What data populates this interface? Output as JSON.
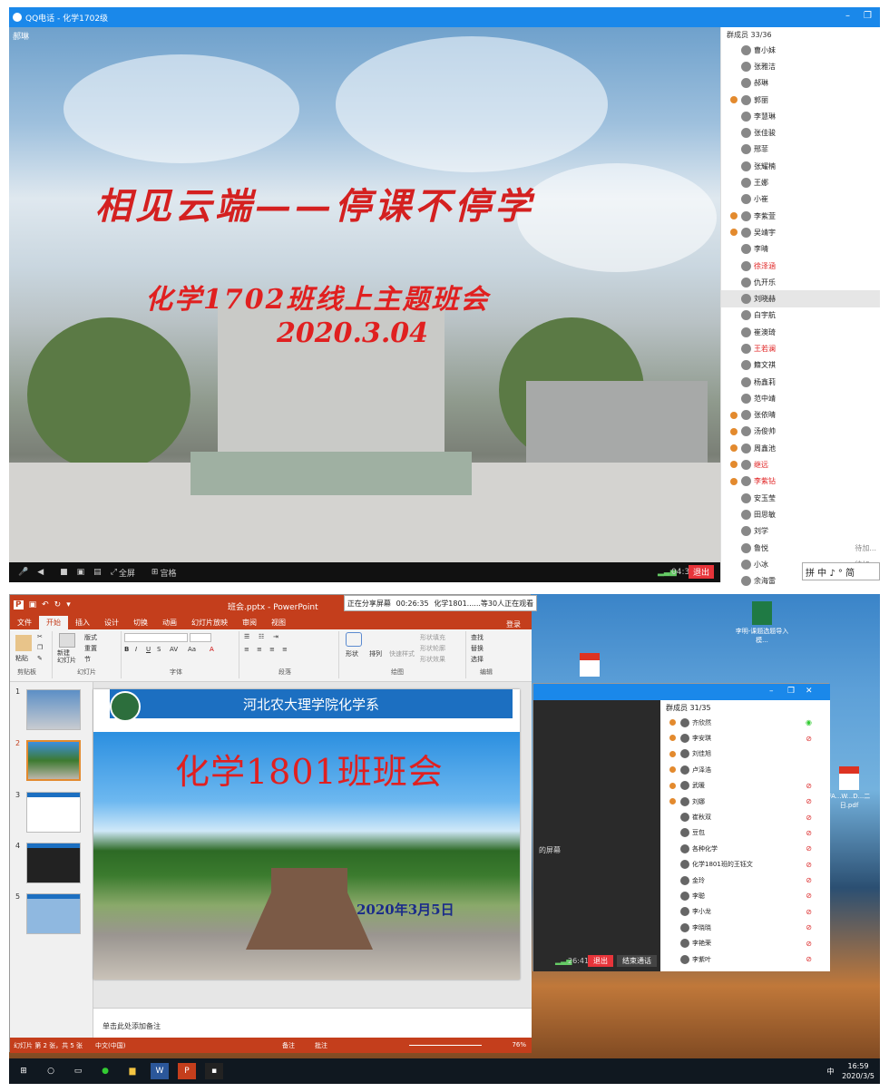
{
  "qq_top": {
    "title": "QQ电话 - 化学1702级",
    "speaker": "郝琳",
    "slide_title": "相见云端——停课不停学",
    "slide_subtitle": "化学1702班线上主题班会",
    "slide_date": "2020.3.04",
    "controls": {
      "fullscreen": "全屏",
      "grid": "宫格",
      "time": "04:34",
      "exit": "退出"
    },
    "member_header": "群成员 33/36",
    "members": [
      {
        "name": "曹小妹",
        "admin": false,
        "red": false
      },
      {
        "name": "张雅洁",
        "admin": false,
        "red": false
      },
      {
        "name": "郝琳",
        "admin": false,
        "red": false
      },
      {
        "name": "郭丽",
        "admin": true,
        "red": false
      },
      {
        "name": "李慧琳",
        "admin": false,
        "red": false
      },
      {
        "name": "张佳骏",
        "admin": false,
        "red": false
      },
      {
        "name": "邢菲",
        "admin": false,
        "red": false
      },
      {
        "name": "张耀楠",
        "admin": false,
        "red": false
      },
      {
        "name": "王娜",
        "admin": false,
        "red": false
      },
      {
        "name": "小崔",
        "admin": false,
        "red": false
      },
      {
        "name": "李紫萱",
        "admin": true,
        "red": false
      },
      {
        "name": "吴靖宇",
        "admin": true,
        "red": false
      },
      {
        "name": "李晴",
        "admin": false,
        "red": false
      },
      {
        "name": "徐泽涵",
        "admin": false,
        "red": true
      },
      {
        "name": "仇开乐",
        "admin": false,
        "red": false
      },
      {
        "name": "刘晓赫",
        "admin": false,
        "red": false,
        "selected": true
      },
      {
        "name": "白宇航",
        "admin": false,
        "red": false
      },
      {
        "name": "崔澳琦",
        "admin": false,
        "red": false
      },
      {
        "name": "王若澜",
        "admin": false,
        "red": true
      },
      {
        "name": "籍文祺",
        "admin": false,
        "red": false
      },
      {
        "name": "杨鑫莉",
        "admin": false,
        "red": false
      },
      {
        "name": "范中靖",
        "admin": false,
        "red": false
      },
      {
        "name": "张依晴",
        "admin": true,
        "red": false
      },
      {
        "name": "汤俊帅",
        "admin": true,
        "red": false
      },
      {
        "name": "周鑫池",
        "admin": true,
        "red": false
      },
      {
        "name": "继远",
        "admin": true,
        "red": true
      },
      {
        "name": "李紫钻",
        "admin": true,
        "red": true
      },
      {
        "name": "安玉莹",
        "admin": false,
        "red": false
      },
      {
        "name": "田思敏",
        "admin": false,
        "red": false
      },
      {
        "name": "刘学",
        "admin": false,
        "red": false
      },
      {
        "name": "鲁悦",
        "admin": false,
        "red": false,
        "status": "待加..."
      },
      {
        "name": "小冰",
        "admin": false,
        "red": false,
        "status": "待加..."
      },
      {
        "name": "余海雷",
        "admin": false,
        "red": false
      }
    ],
    "ime": "拼 中 ♪ ° 简"
  },
  "ppt": {
    "window_title": "班会.pptx - PowerPoint",
    "share_bar": {
      "sharing": "正在分享屏幕",
      "time": "00:26:35",
      "viewers": "化学1801......等30人正在观看"
    },
    "tabs": [
      "文件",
      "开始",
      "插入",
      "设计",
      "切换",
      "动画",
      "幻灯片放映",
      "审阅",
      "视图"
    ],
    "login": "登录",
    "ribbon": {
      "paste": "粘贴",
      "new_slide": "新建\n幻灯片",
      "layout": "版式",
      "reset": "重置",
      "section": "节",
      "shape": "形状",
      "arrange": "排列",
      "quick_style": "快速样式",
      "fill": "形状填充",
      "outline": "形状轮廓",
      "effect": "形状效果",
      "find": "查找",
      "replace": "替换",
      "select": "选择",
      "groups": [
        "剪贴板",
        "幻灯片",
        "字体",
        "段落",
        "绘图",
        "编辑"
      ]
    },
    "thumbs": [
      "1",
      "2",
      "3",
      "4",
      "5"
    ],
    "slide": {
      "banner": "河北农大理学院化学系",
      "title": "化学1801班班会",
      "date": "2020年3月5日"
    },
    "page_number": "2",
    "notes": "单击此处添加备注",
    "status": {
      "left": "幻灯片 第 2 张，共 5 张",
      "lang": "中文(中国)",
      "notes": "备注",
      "comments": "批注",
      "zoom": "76%"
    }
  },
  "qq_bottom": {
    "member_header": "群成员 31/35",
    "left_label": "的屏幕",
    "members": [
      {
        "name": "齐欣然",
        "admin": true,
        "mic": "on"
      },
      {
        "name": "李安琪",
        "admin": true,
        "mic": "off"
      },
      {
        "name": "刘佳旭",
        "admin": true,
        "mic": "none"
      },
      {
        "name": "卢泽浩",
        "admin": true,
        "mic": "none"
      },
      {
        "name": "武暖",
        "admin": true,
        "mic": "off"
      },
      {
        "name": "刘娜",
        "admin": true,
        "mic": "off"
      },
      {
        "name": "崔秋双",
        "admin": false,
        "mic": "off"
      },
      {
        "name": "豆包",
        "admin": false,
        "mic": "off"
      },
      {
        "name": "各种化学",
        "admin": false,
        "mic": "off"
      },
      {
        "name": "化学1801班的王钰文",
        "admin": false,
        "mic": "off"
      },
      {
        "name": "金玲",
        "admin": false,
        "mic": "off"
      },
      {
        "name": "李聪",
        "admin": false,
        "mic": "off"
      },
      {
        "name": "李小龙",
        "admin": false,
        "mic": "off"
      },
      {
        "name": "李晓晓",
        "admin": false,
        "mic": "off"
      },
      {
        "name": "李艳荣",
        "admin": false,
        "mic": "off"
      },
      {
        "name": "李紫叶",
        "admin": false,
        "mic": "off"
      }
    ],
    "controls": {
      "time": "26:41",
      "exit": "退出",
      "end": "结束通话"
    }
  },
  "desktop": {
    "icons": [
      {
        "label": "李明-课题选题导入模..."
      },
      {
        "label": "FA...W...D...二日.pdf"
      }
    ],
    "tray_time": "16:59",
    "tray_date": "2020/3/5",
    "tray_lang": "中"
  }
}
